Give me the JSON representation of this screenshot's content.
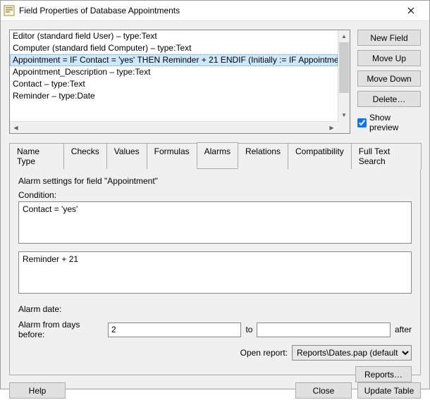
{
  "window": {
    "title": "Field Properties of Database Appointments"
  },
  "fieldList": {
    "items": [
      "Editor (standard field User) – type:Text",
      "Computer (standard field Computer) – type:Text",
      "Appointment = IF Contact = 'yes' THEN Reminder + 21 ENDIF  (Initially := IF Appointmen",
      "Appointment_Description – type:Text",
      "Contact – type:Text",
      "Reminder – type:Date"
    ],
    "selectedIndex": 2
  },
  "sideButtons": {
    "newField": "New Field",
    "moveUp": "Move Up",
    "moveDown": "Move Down",
    "delete": "Delete…",
    "showPreview": "Show preview",
    "showPreviewChecked": true
  },
  "tabs": {
    "items": [
      "Name  Type",
      "Checks",
      "Values",
      "Formulas",
      "Alarms",
      "Relations",
      "Compatibility",
      "Full Text Search"
    ],
    "activeIndex": 4
  },
  "alarmsTab": {
    "title": "Alarm settings for field \"Appointment\"",
    "conditionLabel": "Condition:",
    "conditionValue": "Contact = 'yes'",
    "expressionValue": "Reminder + 21",
    "alarmDateLabel": "Alarm date:",
    "alarmFromLabel": "Alarm from days before:",
    "alarmFromValue": "2",
    "toLabel": "to",
    "toValue": "",
    "afterLabel": "after",
    "openReportLabel": "Open report:",
    "openReportValue": "Reports\\Dates.pap (default report)",
    "reportsButton": "Reports…"
  },
  "bottom": {
    "help": "Help",
    "close": "Close",
    "updateTable": "Update Table"
  }
}
